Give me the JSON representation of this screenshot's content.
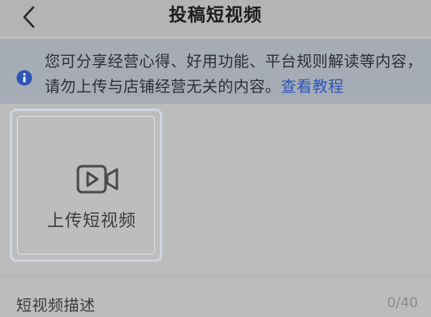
{
  "header": {
    "title": "投稿短视频",
    "back_icon": "chevron-left-icon"
  },
  "notice": {
    "icon": "info-icon",
    "icon_color": "#2e56b8",
    "text": "您可分享经营心得、好用功能、平台规则解读等内容，请勿上传与店铺经营无关的内容。",
    "link_label": "查看教程"
  },
  "upload": {
    "icon": "video-camera-icon",
    "label": "上传短视频"
  },
  "description": {
    "label": "短视频描述",
    "count": "0/40"
  }
}
